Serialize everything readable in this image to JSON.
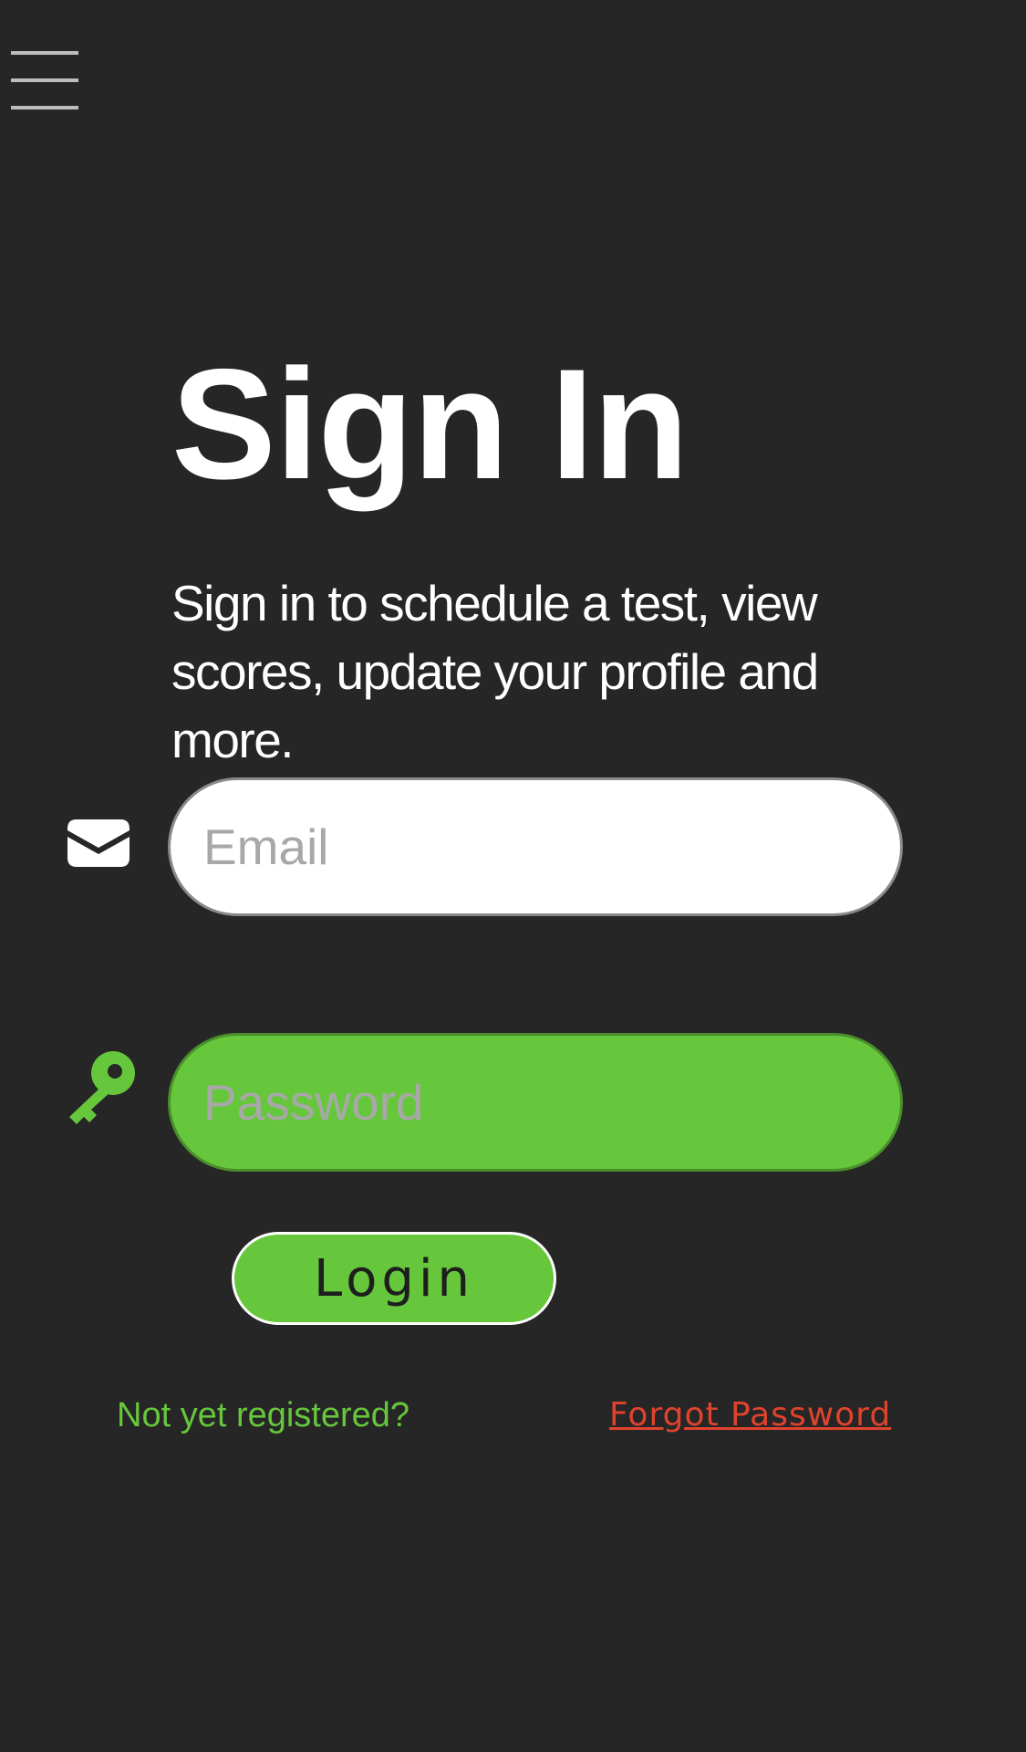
{
  "header": {
    "menu_icon": "hamburger-menu-icon"
  },
  "title": "Sign In",
  "subtitle": "Sign in to schedule a test, view scores, update your profile and more.",
  "email": {
    "icon": "envelope-icon",
    "placeholder": "Email",
    "value": ""
  },
  "password": {
    "icon": "key-icon",
    "placeholder": "Password",
    "value": ""
  },
  "login_label": "Login",
  "register_label": "Not yet registered?",
  "forgot_label": "Forgot Password",
  "colors": {
    "background": "#262626",
    "accent": "#66c73c",
    "link_warning": "#e0432d",
    "text": "#ffffff"
  }
}
